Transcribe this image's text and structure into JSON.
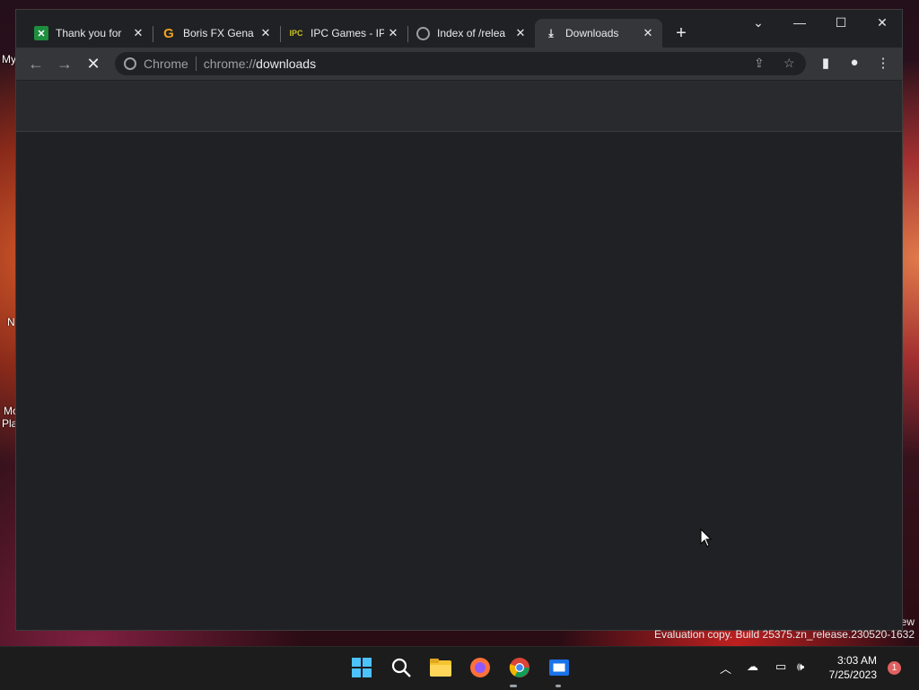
{
  "desktop": {
    "labels": [
      "My",
      "N",
      "Mo",
      "Pla"
    ],
    "corner_text": "ew"
  },
  "tabs": [
    {
      "title": "Thank you for",
      "favicon": "sheets-icon",
      "close": "✕"
    },
    {
      "title": "Boris FX Gena",
      "favicon": "g-icon",
      "close": "✕"
    },
    {
      "title": "IPC Games - IP",
      "favicon": "ipc-icon",
      "close": "✕"
    },
    {
      "title": "Index of /relea",
      "favicon": "globe-icon",
      "close": "✕"
    },
    {
      "title": "Downloads",
      "favicon": "download-icon",
      "close": "✕"
    }
  ],
  "toolbar": {
    "omnibox_chip": "Chrome",
    "url_prefix": "chrome://",
    "url_path": "downloads"
  },
  "watermark": "Evaluation copy. Build 25375.zn_release.230520-1632",
  "taskbar": {
    "time": "3:03 AM",
    "date": "7/25/2023",
    "notification_count": "1"
  }
}
